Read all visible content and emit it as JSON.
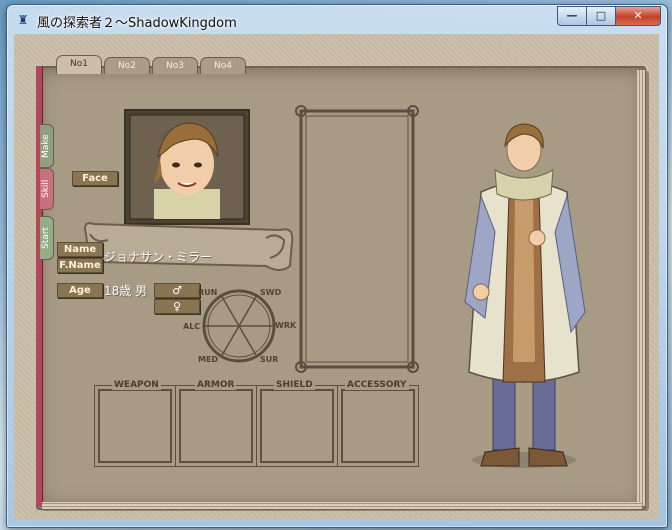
{
  "window": {
    "title": "風の探索者２～ShadowKingdom",
    "icon": "castle-icon",
    "minimize_glyph": "—",
    "maximize_glyph": "□",
    "close_glyph": "✕"
  },
  "tabs": [
    "No1",
    "No2",
    "No3",
    "No4"
  ],
  "active_tab": 0,
  "side_tabs": [
    {
      "label": "Make",
      "color": "#8fa07e"
    },
    {
      "label": "Skill",
      "color": "#c9707f"
    },
    {
      "label": "Start",
      "color": "#93ad86"
    }
  ],
  "character": {
    "face_label": "Face",
    "name_label": "Name",
    "fname_label": "F.Name",
    "age_label": "Age",
    "full_name": "ジョナサン・ミラー",
    "age_sex": "18歳 男",
    "male_symbol": "♂",
    "female_symbol": "♀"
  },
  "stats": [
    "SWD",
    "WRK",
    "SUR",
    "MED",
    "ALC",
    "RUN"
  ],
  "equipment": [
    "WEAPON",
    "ARMOR",
    "SHIELD",
    "ACCESSORY"
  ],
  "colors": {
    "book": "#a79b86",
    "label_bg": "#8a7552",
    "spine": "#b0485a"
  }
}
